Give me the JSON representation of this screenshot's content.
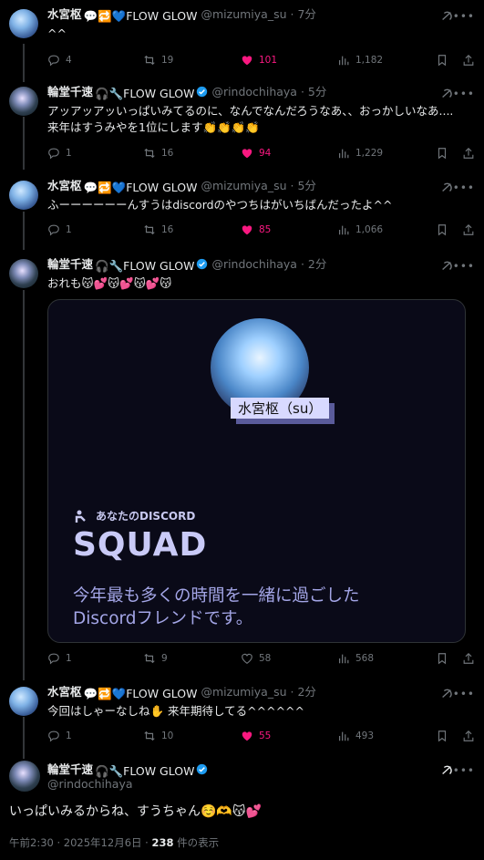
{
  "tweets": [
    {
      "name": "水宮枢",
      "badges": "💬🔁💙FLOW GLOW",
      "handle": "@mizumiya_su",
      "time": "· 7分",
      "text": "^^",
      "replies": "4",
      "retweets": "19",
      "likes": "101",
      "views": "1,182",
      "liked": true
    },
    {
      "name": "輪堂千速",
      "badges": "🎧🔧FLOW GLOW",
      "handle": "@rindochihaya",
      "time": "· 5分",
      "text": "アッアッアッいっぱいみてるのに、なんでなんだろうなあ、、おっかしいなあ....\n来年はすうみやを1位にします👏👏👏👏",
      "replies": "1",
      "retweets": "16",
      "likes": "94",
      "views": "1,229",
      "liked": true
    },
    {
      "name": "水宮枢",
      "badges": "💬🔁💙FLOW GLOW",
      "handle": "@mizumiya_su",
      "time": "· 5分",
      "text": "ふーーーーーーんすうはdiscordのやつちはがいちばんだったよ^^",
      "replies": "1",
      "retweets": "16",
      "likes": "85",
      "views": "1,066",
      "liked": true
    },
    {
      "name": "輪堂千速",
      "badges": "🎧🔧FLOW GLOW",
      "handle": "@rindochihaya",
      "time": "· 2分",
      "text": "おれも😽💕😽💕😽💕😽",
      "replies": "1",
      "retweets": "9",
      "likes": "58",
      "views": "568",
      "liked": false
    },
    {
      "name": "水宮枢",
      "badges": "💬🔁💙FLOW GLOW",
      "handle": "@mizumiya_su",
      "time": "· 2分",
      "text": "今回はしゃーなしね✋ 来年期待してる^^^^^^",
      "replies": "1",
      "retweets": "10",
      "likes": "55",
      "views": "493",
      "liked": true
    }
  ],
  "card": {
    "label": "水宮枢（su）",
    "mark": "あなたのDISCORD",
    "title": "SQUAD",
    "subtitle_line1": "今年最も多くの時間を一緒に過ごした",
    "subtitle_line2": "Discordフレンドです。"
  },
  "main": {
    "name": "輪堂千速",
    "badges": "🎧🔧FLOW GLOW",
    "handle": "@rindochihaya",
    "text": "いっぱいみるからね、すうちゃん☺️🫶😽💕",
    "meta_time": "午前2:30 · 2025年12月6日 · ",
    "meta_views": "238",
    "meta_suffix": " 件の表示"
  },
  "colors": {
    "like": "#f91880",
    "verified": "#1d9bf0",
    "muted": "#71767b"
  }
}
